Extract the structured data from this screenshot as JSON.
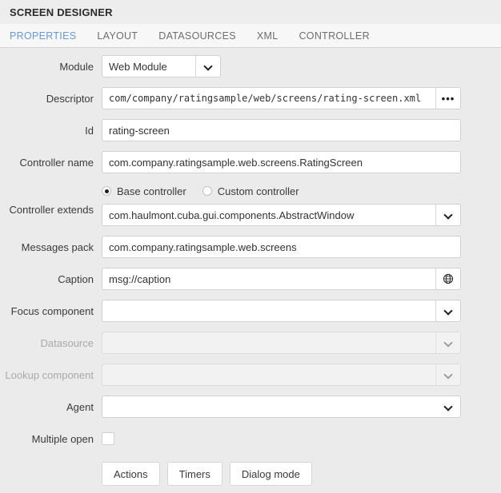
{
  "header": {
    "title": "SCREEN DESIGNER"
  },
  "tabs": [
    {
      "label": "PROPERTIES",
      "active": true
    },
    {
      "label": "LAYOUT",
      "active": false
    },
    {
      "label": "DATASOURCES",
      "active": false
    },
    {
      "label": "XML",
      "active": false
    },
    {
      "label": "CONTROLLER",
      "active": false
    }
  ],
  "form": {
    "module": {
      "label": "Module",
      "value": "Web Module",
      "icon": "chevron-down-icon"
    },
    "descriptor": {
      "label": "Descriptor",
      "value": "com/company/ratingsample/web/screens/rating-screen.xml",
      "button_label": "•••",
      "icon": "ellipsis-icon"
    },
    "id": {
      "label": "Id",
      "value": "rating-screen"
    },
    "controller_name": {
      "label": "Controller name",
      "value": "com.company.ratingsample.web.screens.RatingScreen"
    },
    "controller_extends": {
      "label": "Controller extends",
      "radios": [
        {
          "label": "Base controller",
          "checked": true
        },
        {
          "label": "Custom controller",
          "checked": false
        }
      ],
      "value": "com.haulmont.cuba.gui.components.AbstractWindow",
      "icon": "chevron-down-icon"
    },
    "messages_pack": {
      "label": "Messages pack",
      "value": "com.company.ratingsample.web.screens"
    },
    "caption": {
      "label": "Caption",
      "value": "msg://caption",
      "icon": "globe-icon"
    },
    "focus_component": {
      "label": "Focus component",
      "value": "",
      "icon": "chevron-down-icon",
      "disabled": false
    },
    "datasource": {
      "label": "Datasource",
      "value": "",
      "icon": "chevron-down-icon",
      "disabled": true
    },
    "lookup_component": {
      "label": "Lookup component",
      "value": "",
      "icon": "chevron-down-icon",
      "disabled": true
    },
    "agent": {
      "label": "Agent",
      "value": "",
      "icon": "chevron-down-icon",
      "disabled": false
    },
    "multiple_open": {
      "label": "Multiple open",
      "checked": false
    },
    "buttons": [
      {
        "label": "Actions"
      },
      {
        "label": "Timers"
      },
      {
        "label": "Dialog mode"
      }
    ]
  },
  "colors": {
    "active_tab": "#6699dd",
    "page_background": "#ebebeb",
    "header_background": "#ededed",
    "tabbar_background": "#f7f7f7",
    "field_background": "#ffffff",
    "disabled_field_background": "#f2f2f2"
  }
}
